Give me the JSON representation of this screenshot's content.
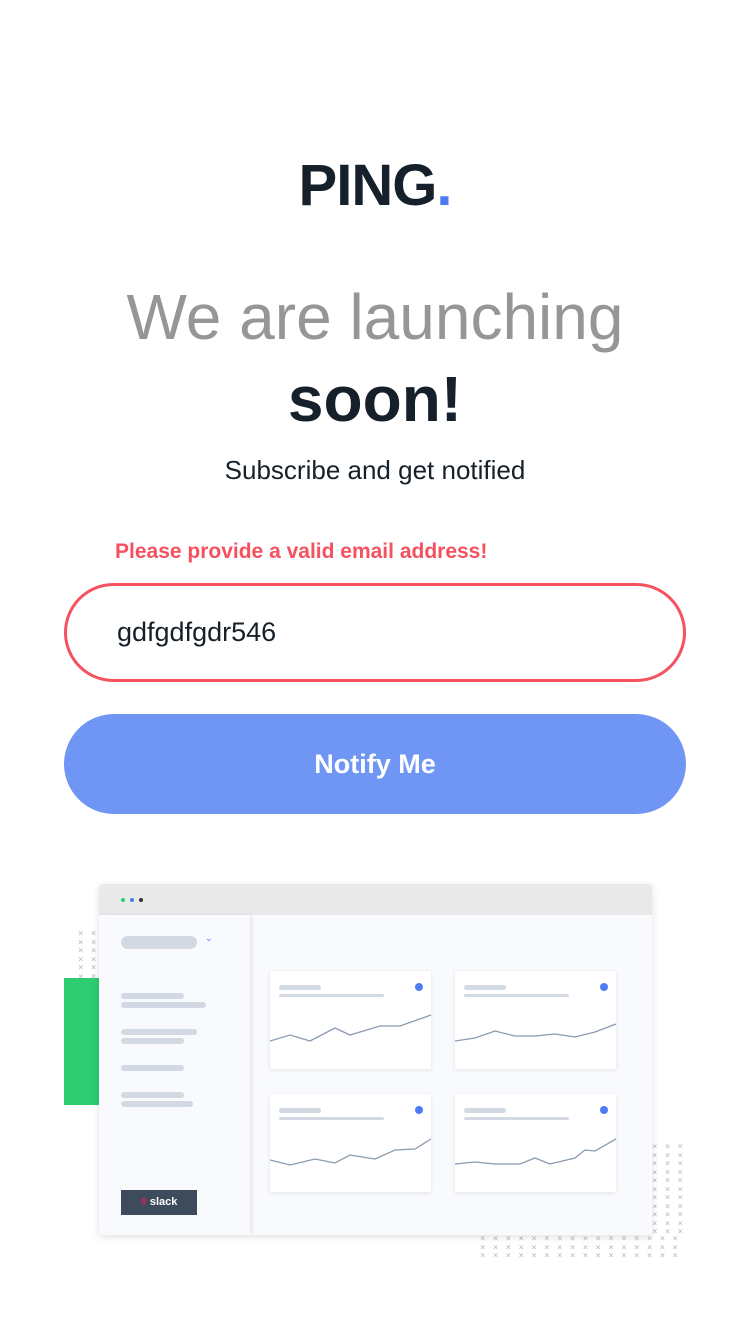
{
  "logo": {
    "text": "PING",
    "dot": "."
  },
  "headline": {
    "line1": "We are launching",
    "line2": "soon!"
  },
  "subtitle": "Subscribe and get notified",
  "form": {
    "error": "Please provide a valid email address!",
    "email_value": "gdfgdfgdr546",
    "button": "Notify Me"
  },
  "illustration": {
    "slack_label": "slack"
  },
  "colors": {
    "accent": "#4c7bf3",
    "error": "#f5515f",
    "button": "#7096f5",
    "dark": "#15202b",
    "green": "#2ecc71"
  }
}
